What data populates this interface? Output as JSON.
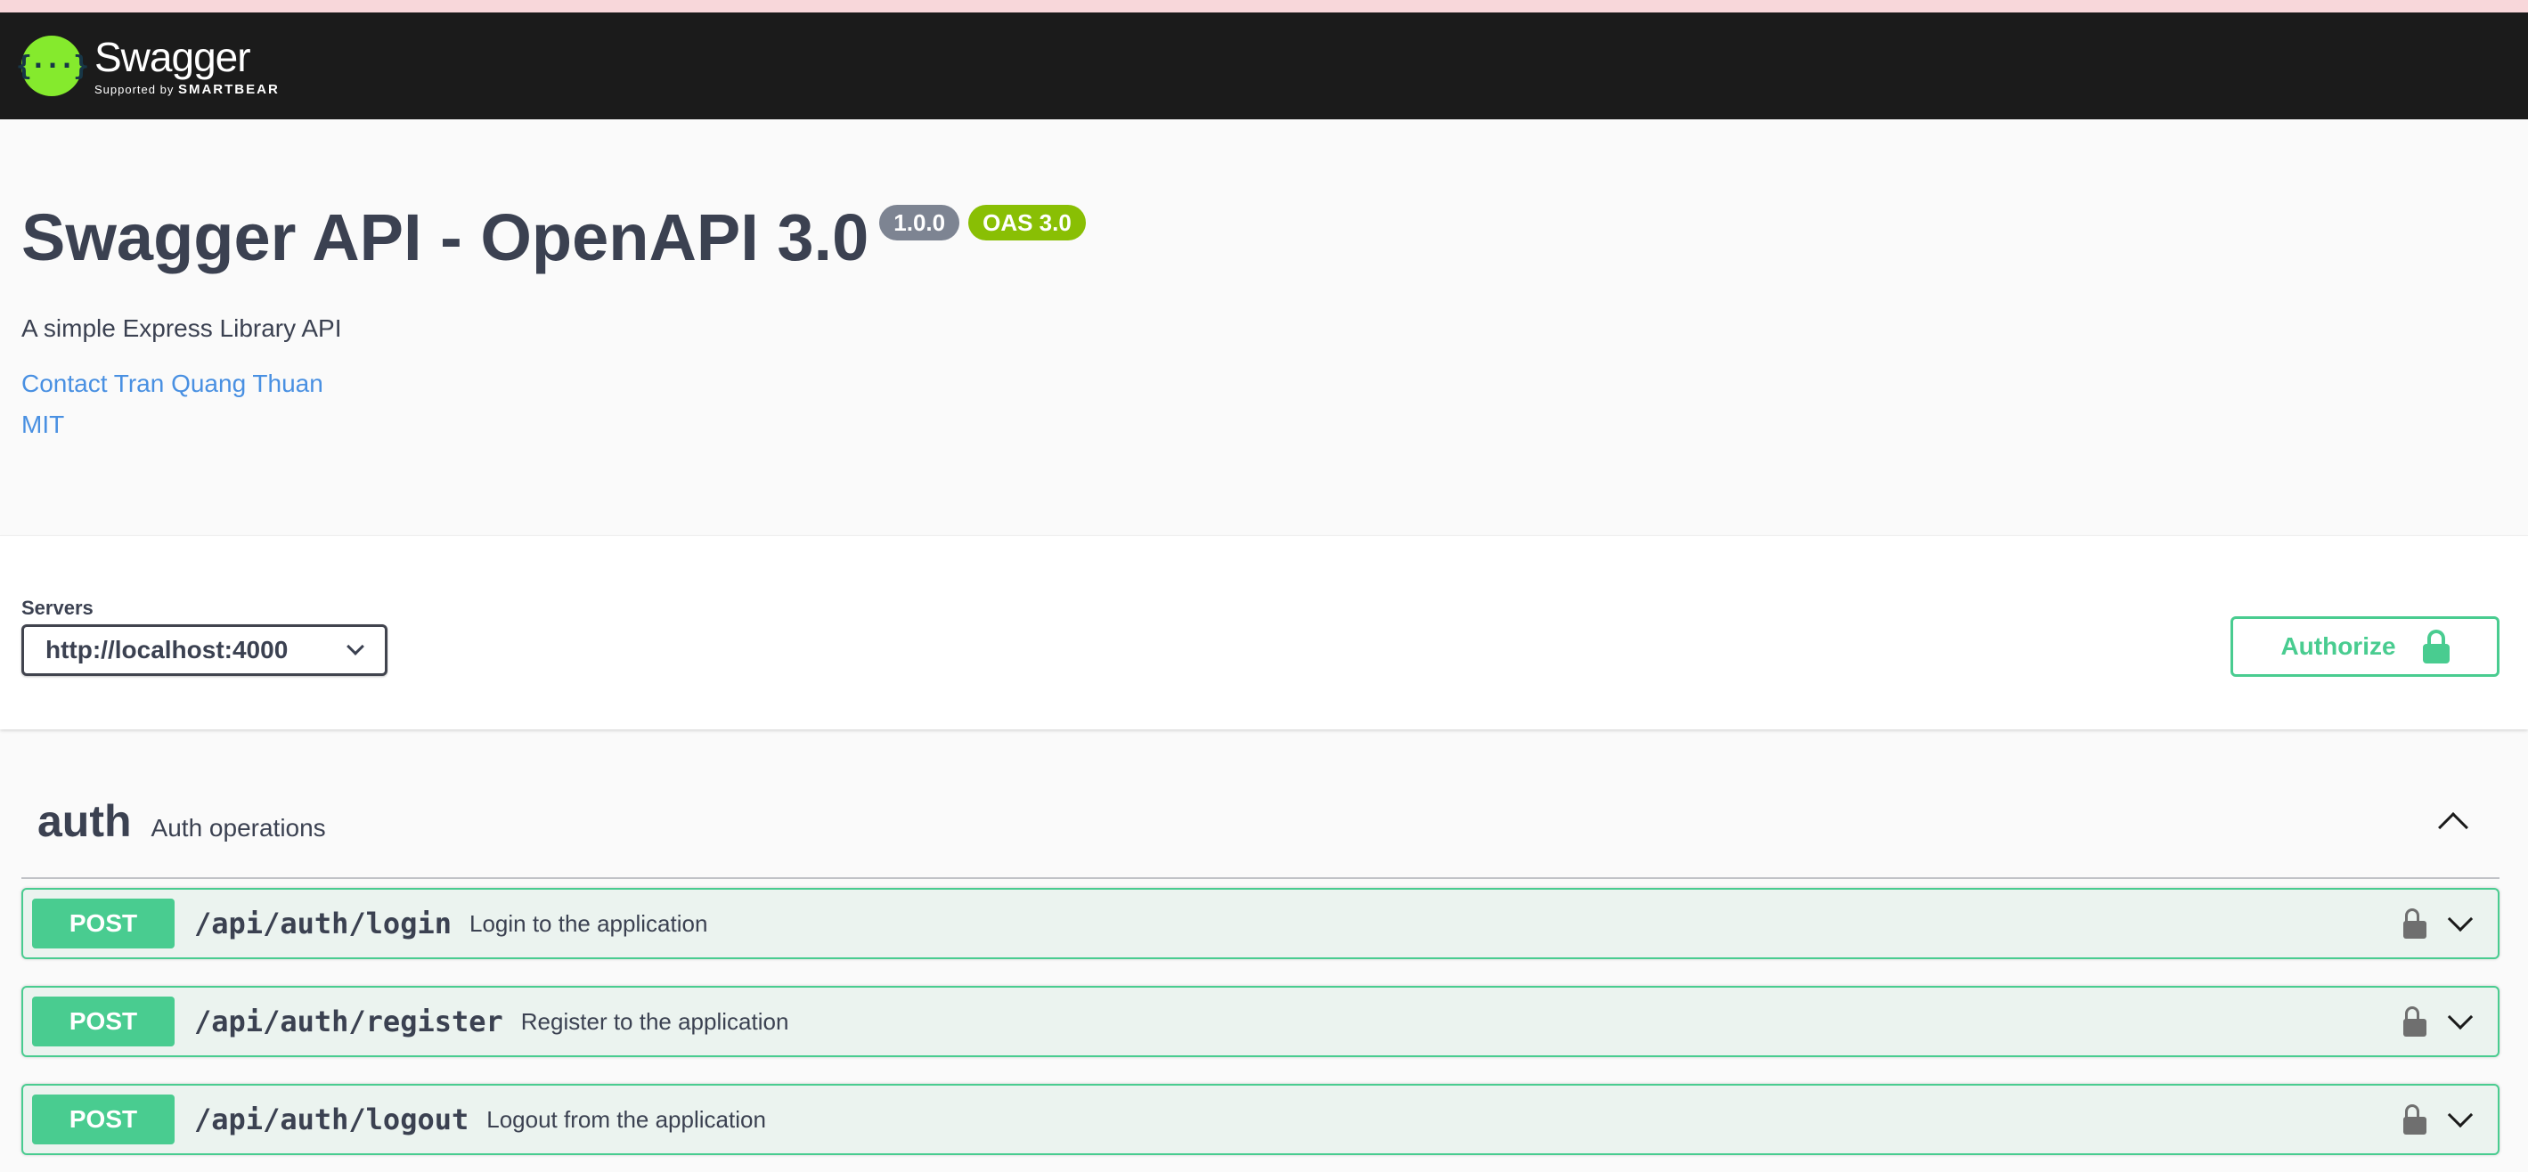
{
  "header": {
    "logo_word": "Swagger",
    "logo_sub_prefix": "Supported by",
    "logo_sub_brand": "SMARTBEAR",
    "logo_mark": "{···}"
  },
  "info": {
    "title": "Swagger API - OpenAPI 3.0",
    "version_badge": "1.0.0",
    "oas_badge": "OAS 3.0",
    "description": "A simple Express Library API",
    "contact_link": "Contact Tran Quang Thuan",
    "license_link": "MIT"
  },
  "servers": {
    "label": "Servers",
    "selected": "http://localhost:4000"
  },
  "authorize": {
    "label": "Authorize"
  },
  "tag": {
    "name": "auth",
    "description": "Auth operations",
    "operations": [
      {
        "method": "POST",
        "path": "/api/auth/login",
        "summary": "Login to the application"
      },
      {
        "method": "POST",
        "path": "/api/auth/register",
        "summary": "Register to the application"
      },
      {
        "method": "POST",
        "path": "/api/auth/logout",
        "summary": "Logout from the application"
      }
    ]
  },
  "colors": {
    "post": "#49cc90",
    "link": "#4990e2",
    "header_bg": "#1b1b1b",
    "logo_green": "#85ea2d"
  }
}
